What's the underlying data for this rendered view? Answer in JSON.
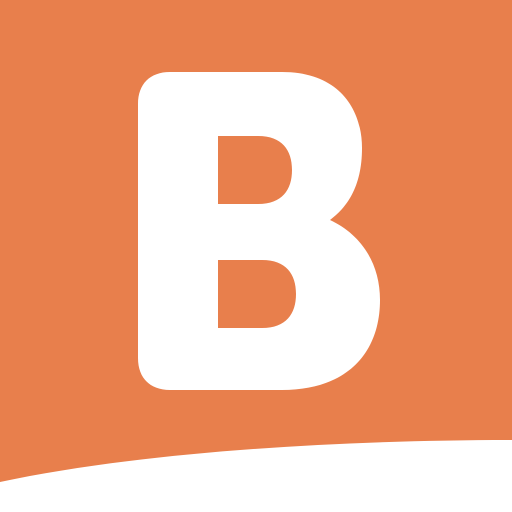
{
  "logo": {
    "letter": "B",
    "icon": "b-letter-logo-icon"
  },
  "colors": {
    "brand_orange": "#E87F4C",
    "white": "#FFFFFF"
  }
}
